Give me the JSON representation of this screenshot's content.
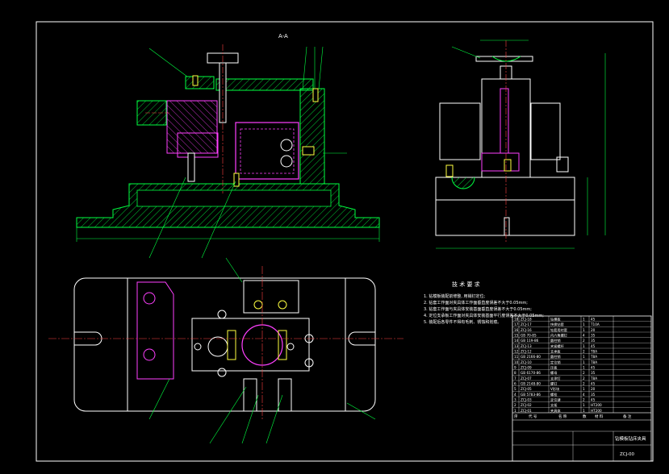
{
  "section_label": "A-A",
  "tech_requirements": {
    "heading": "技 术 要 求",
    "items": [
      "1. 钻模板装配前修整, 用销钉定位;",
      "2. 钻套工作面对夹具体工作面垂直度误差不大于0.05mm;",
      "3. 钻套工作面与夹具体安装基面垂直度误差不大于0.05mm;",
      "4. 定位支承板工作面对夹具体安装基面平行度误差不大于0.05mm;",
      "5. 装配后各零件不得有毛刺、锈蚀和划痕。"
    ]
  },
  "title_block": {
    "name": "钻模板钻床夹具",
    "drawing_no": "ZCJ-00",
    "header_cols": [
      "序",
      "代 号",
      "名 称",
      "数",
      "材 料",
      "备 注"
    ]
  },
  "bom_rows": [
    [
      "18",
      "ZCJ-18",
      "钻模板",
      "1",
      "45",
      ""
    ],
    [
      "17",
      "ZCJ-17",
      "快换钻套",
      "1",
      "T10A",
      ""
    ],
    [
      "16",
      "ZCJ-16",
      "钻套用衬套",
      "1",
      "20",
      ""
    ],
    [
      "15",
      "GB 70-85",
      "内六角螺钉",
      "4",
      "35",
      ""
    ],
    [
      "14",
      "GB 119-86",
      "圆柱销",
      "2",
      "35",
      ""
    ],
    [
      "13",
      "ZCJ-13",
      "夹紧螺杆",
      "1",
      "45",
      ""
    ],
    [
      "12",
      "ZCJ-12",
      "支承板",
      "2",
      "T8A",
      ""
    ],
    [
      "11",
      "GB 2166-80",
      "圆柱销",
      "1",
      "T8A",
      ""
    ],
    [
      "10",
      "ZCJ-10",
      "定位销",
      "1",
      "T8A",
      ""
    ],
    [
      "9",
      "ZCJ-09",
      "压板",
      "1",
      "45",
      ""
    ],
    [
      "8",
      "GB 6170-86",
      "螺母",
      "2",
      "35",
      ""
    ],
    [
      "7",
      "ZCJ-07",
      "支承钉",
      "2",
      "T8A",
      ""
    ],
    [
      "6",
      "GB 2148-80",
      "螺钉",
      "2",
      "45",
      ""
    ],
    [
      "5",
      "ZCJ-05",
      "V形块",
      "1",
      "20",
      ""
    ],
    [
      "4",
      "GB 5783-86",
      "螺栓",
      "4",
      "35",
      ""
    ],
    [
      "3",
      "ZCJ-03",
      "定位键",
      "2",
      "45",
      ""
    ],
    [
      "2",
      "ZCJ-02",
      "支架",
      "1",
      "HT200",
      ""
    ],
    [
      "1",
      "ZCJ-01",
      "夹具体",
      "1",
      "HT200",
      ""
    ]
  ],
  "colors": {
    "background": "#000000",
    "border": "#ffffff",
    "outline": "#00ff40",
    "hatch": "#00ff40",
    "part": "#ff40ff",
    "dimension": "#00ff40",
    "text": "#ffffff",
    "center": "#ff4040",
    "yellow": "#ffff40"
  }
}
